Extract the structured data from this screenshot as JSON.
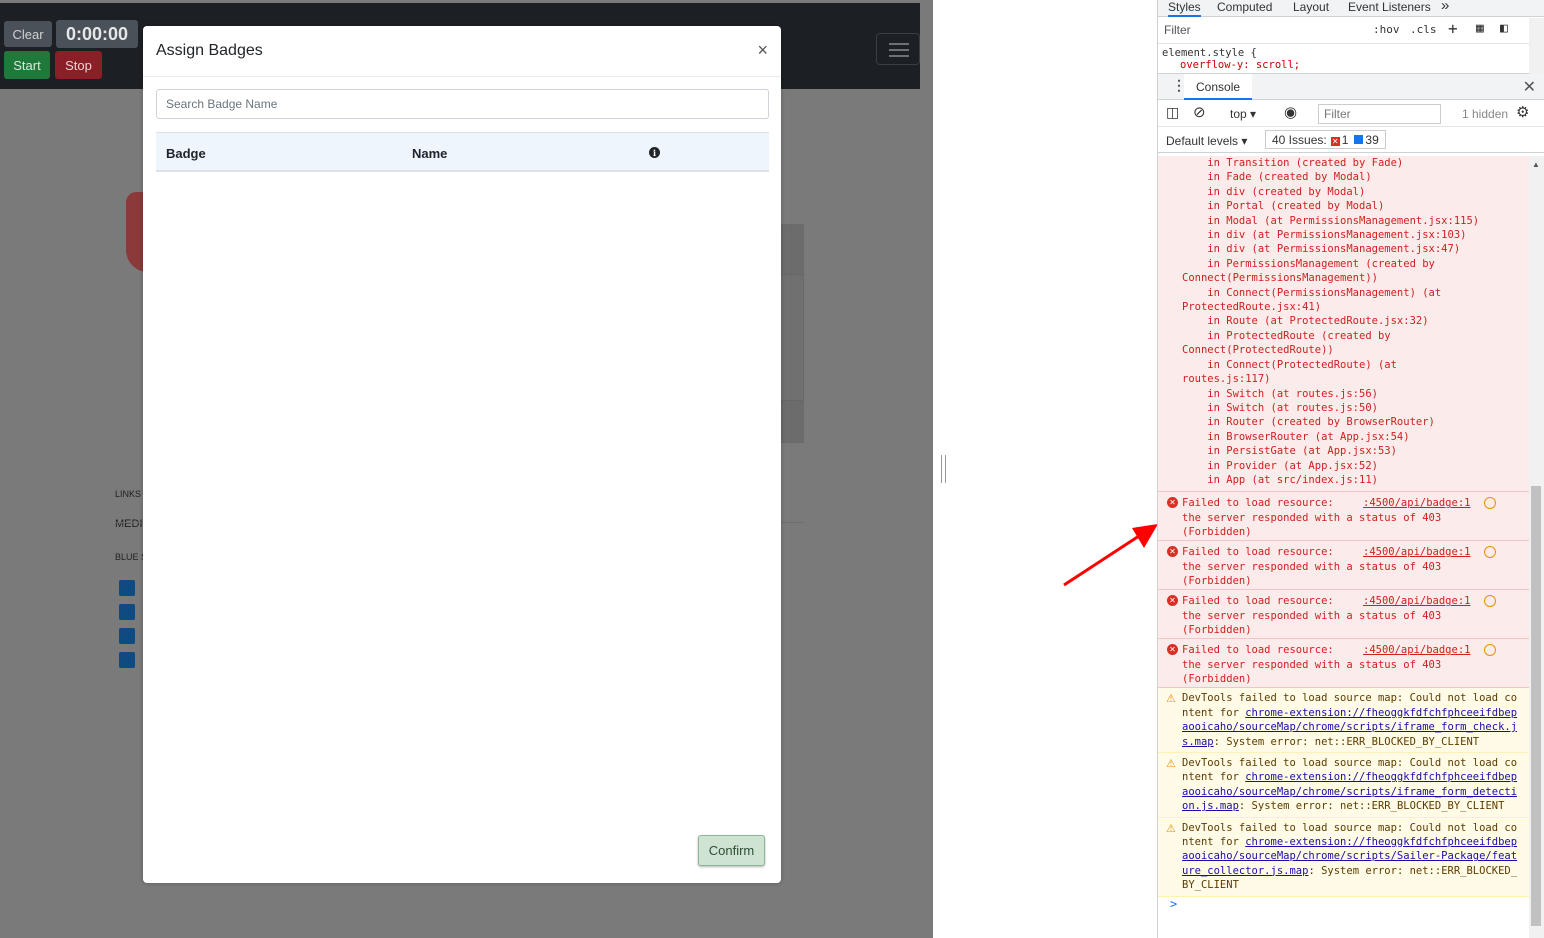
{
  "page": {
    "timer": {
      "clear_label": "Clear",
      "time": "0:00:00",
      "start_label": "Start",
      "stop_label": "Stop"
    },
    "background": {
      "links_label": "LINKS",
      "media_label": "MEDI",
      "blue_label": "BLUE S"
    },
    "modal": {
      "title": "Assign Badges",
      "close_glyph": "×",
      "search_placeholder": "Search Badge Name",
      "columns": [
        "Badge",
        "Name"
      ],
      "info_glyph": "i",
      "confirm_label": "Confirm"
    }
  },
  "devtools": {
    "styles_tabs": [
      "Styles",
      "Computed",
      "Layout",
      "Event Listeners"
    ],
    "more_tabs_glyph": "»",
    "styles_filter_placeholder": "Filter",
    "hov": ":hov",
    "cls": ".cls",
    "element_style_selector": "element.style {",
    "element_style_prop": "overflow-y: scroll;",
    "console_tab": "Console",
    "context": "top",
    "console_filter_placeholder": "Filter",
    "hidden": "1 hidden",
    "default_levels": "Default levels",
    "issues_label": "40 Issues:",
    "issues_errors": "1",
    "issues_info": "39",
    "stack_lines": [
      "    in Transition (created by Fade)",
      "    in Fade (created by Modal)",
      "    in div (created by Modal)",
      "    in Portal (created by Modal)",
      "    in Modal (at PermissionsManagement.jsx:115)",
      "    in div (at PermissionsManagement.jsx:103)",
      "    in div (at PermissionsManagement.jsx:47)",
      "    in PermissionsManagement (created by",
      "Connect(PermissionsManagement))",
      "    in Connect(PermissionsManagement) (at",
      "ProtectedRoute.jsx:41)",
      "    in Route (at ProtectedRoute.jsx:32)",
      "    in ProtectedRoute (created by",
      "Connect(ProtectedRoute))",
      "    in Connect(ProtectedRoute) (at",
      "routes.js:117)",
      "    in Switch (at routes.js:56)",
      "    in Switch (at routes.js:50)",
      "    in Router (created by BrowserRouter)",
      "    in BrowserRouter (at App.jsx:54)",
      "    in PersistGate (at App.jsx:53)",
      "    in Provider (at App.jsx:52)",
      "    in App (at src/index.js:11)"
    ],
    "errors": [
      {
        "line1": "Failed to load resource:",
        "source": ":4500/api/badge:1",
        "line2": "the server responded with a status of 403",
        "line3": "(Forbidden)"
      },
      {
        "line1": "Failed to load resource:",
        "source": ":4500/api/badge:1",
        "line2": "the server responded with a status of 403",
        "line3": "(Forbidden)"
      },
      {
        "line1": "Failed to load resource:",
        "source": ":4500/api/badge:1",
        "line2": "the server responded with a status of 403",
        "line3": "(Forbidden)"
      },
      {
        "line1": "Failed to load resource:",
        "source": ":4500/api/badge:1",
        "line2": "the server responded with a status of 403",
        "line3": "(Forbidden)"
      }
    ],
    "warnings": [
      {
        "pre": "DevTools failed to load source map: Could not load content for ",
        "link": "chrome-extension://fheoggkfdfchfphceeifdbepaooicaho/sourceMap/chrome/scripts/iframe_form_check.js.map",
        "post": ": System error: net::ERR_BLOCKED_BY_CLIENT"
      },
      {
        "pre": "DevTools failed to load source map: Could not load content for ",
        "link": "chrome-extension://fheoggkfdfchfphceeifdbepaooicaho/sourceMap/chrome/scripts/iframe_form_detection.js.map",
        "post": ": System error: net::ERR_BLOCKED_BY_CLIENT"
      },
      {
        "pre": "DevTools failed to load source map: Could not load content for ",
        "link": "chrome-extension://fheoggkfdfchfphceeifdbepaooicaho/sourceMap/chrome/scripts/Sailer-Package/feature_collector.js.map",
        "post": ": System error: net::ERR_BLOCKED_BY_CLIENT"
      }
    ],
    "prompt_glyph": ">"
  },
  "colors": {
    "error": "#d02020",
    "warning_bg": "#fffbe6",
    "error_bg": "#fcebeb",
    "accent": "#1a73e8",
    "arrow": "#ff0000"
  }
}
